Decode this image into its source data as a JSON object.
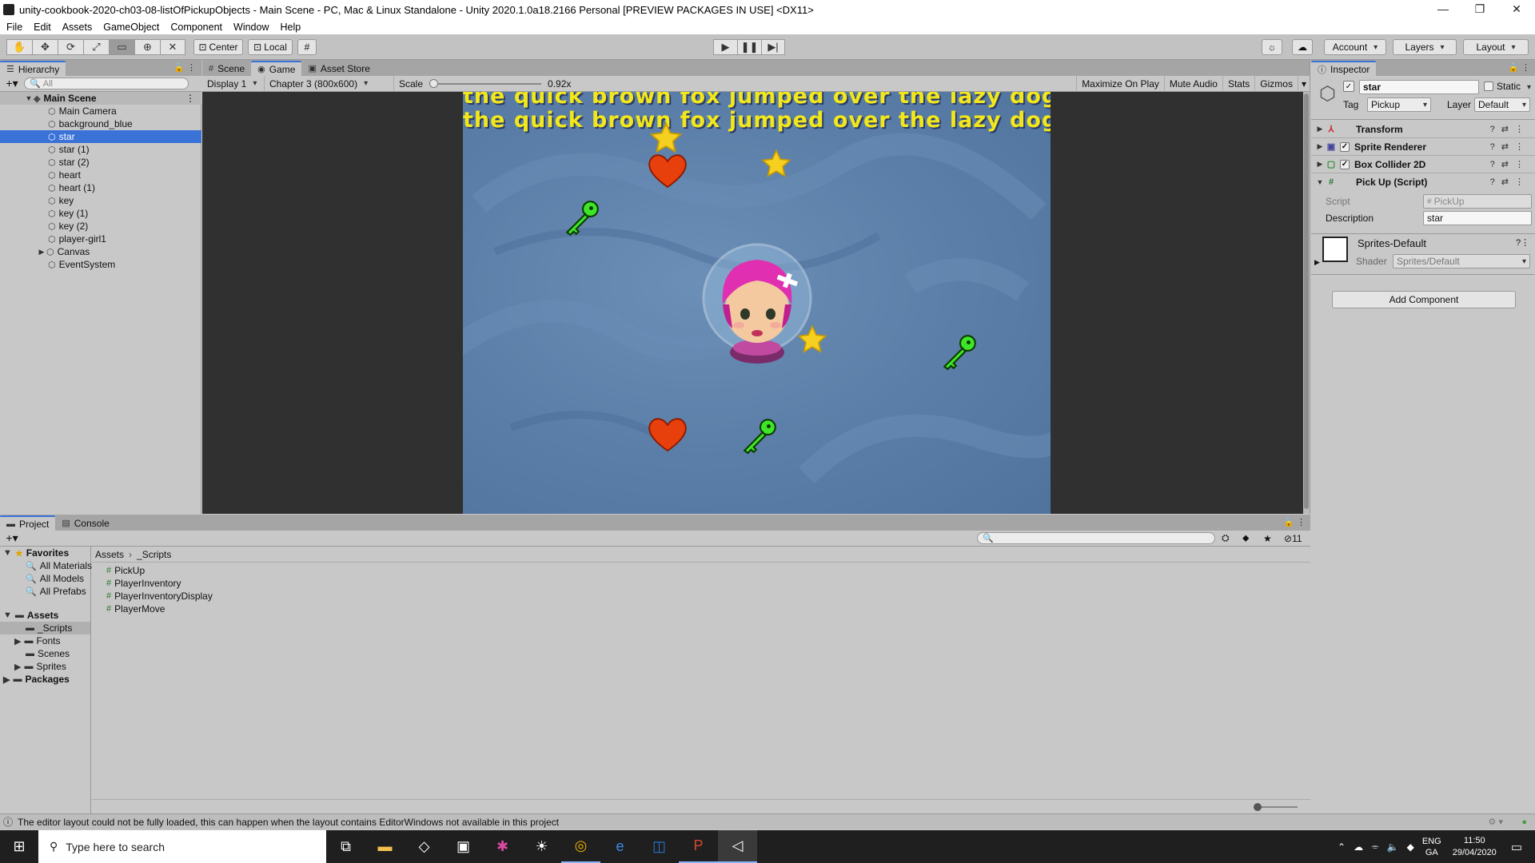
{
  "window": {
    "title": "unity-cookbook-2020-ch03-08-listOfPickupObjects - Main Scene - PC, Mac & Linux Standalone - Unity 2020.1.0a18.2166 Personal [PREVIEW PACKAGES IN USE] <DX11>",
    "minimize": "—",
    "maximize": "❐",
    "close": "✕"
  },
  "menu": [
    "File",
    "Edit",
    "Assets",
    "GameObject",
    "Component",
    "Window",
    "Help"
  ],
  "toolbar": {
    "pivot": "Center",
    "space": "Local",
    "account": "Account",
    "layers": "Layers",
    "layout": "Layout"
  },
  "hierarchy": {
    "tab": "Hierarchy",
    "search_placeholder": "All",
    "scene": "Main Scene",
    "items": [
      {
        "label": "Main Camera"
      },
      {
        "label": "background_blue"
      },
      {
        "label": "star"
      },
      {
        "label": "star (1)"
      },
      {
        "label": "star (2)"
      },
      {
        "label": "heart"
      },
      {
        "label": "heart (1)"
      },
      {
        "label": "key"
      },
      {
        "label": "key (1)"
      },
      {
        "label": "key (2)"
      },
      {
        "label": "player-girl1"
      },
      {
        "label": "Canvas"
      },
      {
        "label": "EventSystem"
      }
    ]
  },
  "center_tabs": [
    "Scene",
    "Game",
    "Asset Store"
  ],
  "game": {
    "display": "Display 1",
    "resolution": "Chapter 3 (800x600)",
    "scale_label": "Scale",
    "scale_value": "0.92x",
    "maximize": "Maximize On Play",
    "mute": "Mute Audio",
    "stats": "Stats",
    "gizmos": "Gizmos",
    "text_line1": "the quick brown fox jumped over the lazy dog",
    "text_line2": "the quick brown fox jumped over the lazy dog"
  },
  "inspector": {
    "tab": "Inspector",
    "name": "star",
    "static": "Static",
    "tag_label": "Tag",
    "tag_value": "Pickup",
    "layer_label": "Layer",
    "layer_value": "Default",
    "components": [
      "Transform",
      "Sprite Renderer",
      "Box Collider 2D",
      "Pick Up (Script)"
    ],
    "script_label": "Script",
    "script_value": "PickUp",
    "description_label": "Description",
    "description_value": "star",
    "material_name": "Sprites-Default",
    "shader_label": "Shader",
    "shader_value": "Sprites/Default",
    "add_component": "Add Component"
  },
  "project": {
    "tabs": [
      "Project",
      "Console"
    ],
    "hidden_count": "11",
    "favorites": "Favorites",
    "favorite_items": [
      "All Materials",
      "All Models",
      "All Prefabs"
    ],
    "assets": "Assets",
    "asset_folders": [
      "_Scripts",
      "Fonts",
      "Scenes",
      "Sprites"
    ],
    "packages": "Packages",
    "breadcrumb_root": "Assets",
    "breadcrumb_current": "_Scripts",
    "files": [
      "PickUp",
      "PlayerInventory",
      "PlayerInventoryDisplay",
      "PlayerMove"
    ]
  },
  "status": {
    "message": "The editor layout could not be fully loaded, this can happen when the layout contains EditorWindows not available in this project"
  },
  "taskbar": {
    "search_placeholder": "Type here to search",
    "lang_top": "ENG",
    "lang_bottom": "GA",
    "time": "11:50",
    "date": "29/04/2020"
  }
}
